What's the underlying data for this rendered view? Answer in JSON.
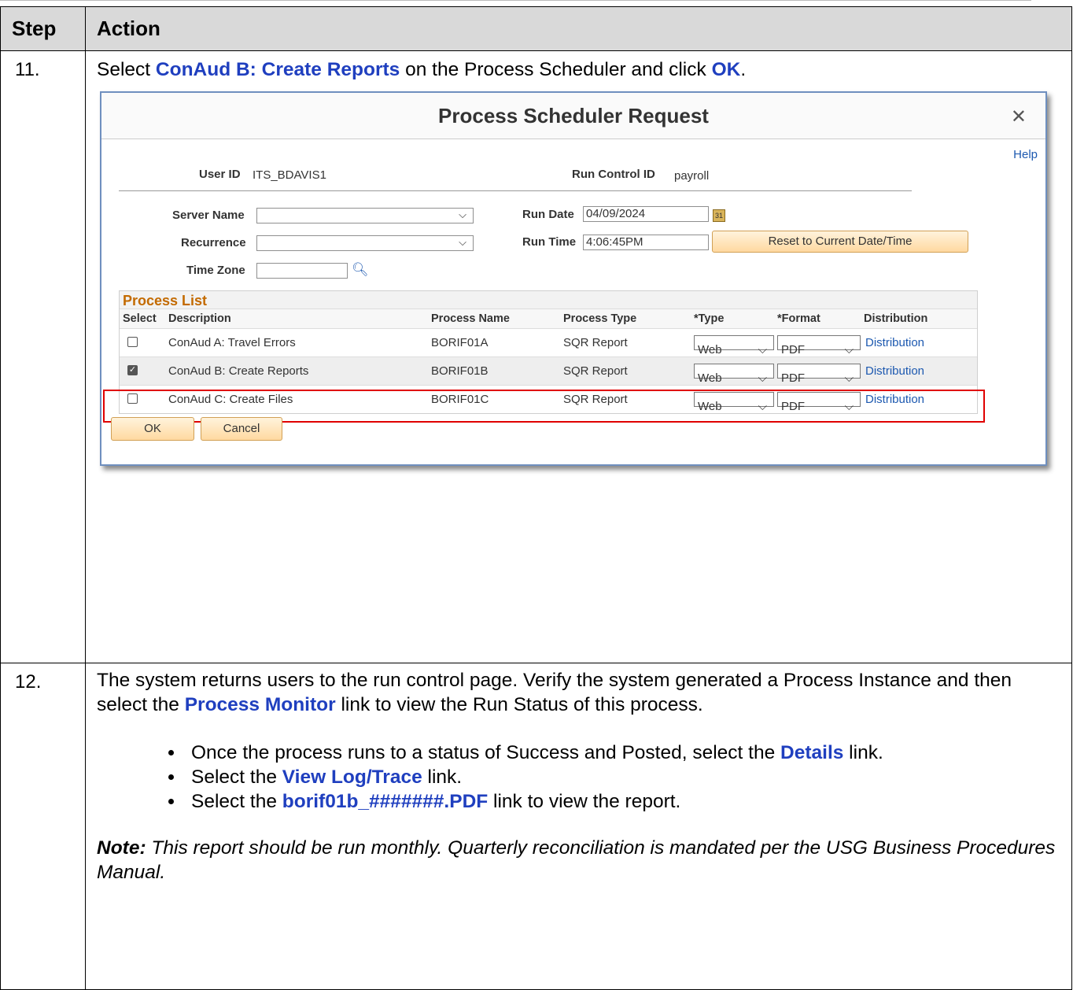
{
  "table": {
    "header_step": "Step",
    "header_action": "Action"
  },
  "step11": {
    "number": "11.",
    "text_prefix": "Select ",
    "link1": "ConAud B: Create Reports",
    "text_mid": " on the Process Scheduler and click ",
    "link2": "OK",
    "text_suffix": "."
  },
  "dialog": {
    "title": "Process Scheduler Request",
    "close_icon": "close-icon",
    "help": "Help",
    "user_id_label": "User ID",
    "user_id_value": "ITS_BDAVIS1",
    "run_control_label": "Run Control ID",
    "run_control_value": "payroll",
    "server_name_label": "Server Name",
    "server_name_value": "",
    "recurrence_label": "Recurrence",
    "recurrence_value": "",
    "time_zone_label": "Time Zone",
    "time_zone_value": "",
    "run_date_label": "Run Date",
    "run_date_value": "04/09/2024",
    "run_time_label": "Run Time",
    "run_time_value": "4:06:45PM",
    "reset_button": "Reset to Current Date/Time",
    "process_list_title": "Process List",
    "columns": [
      "Select",
      "Description",
      "Process Name",
      "Process Type",
      "*Type",
      "*Format",
      "Distribution"
    ],
    "rows": [
      {
        "checked": false,
        "description": "ConAud A: Travel Errors",
        "process_name": "BORIF01A",
        "process_type": "SQR Report",
        "type": "Web",
        "format": "PDF",
        "distribution": "Distribution"
      },
      {
        "checked": true,
        "description": "ConAud B: Create Reports",
        "process_name": "BORIF01B",
        "process_type": "SQR Report",
        "type": "Web",
        "format": "PDF",
        "distribution": "Distribution"
      },
      {
        "checked": false,
        "description": "ConAud C: Create Files",
        "process_name": "BORIF01C",
        "process_type": "SQR Report",
        "type": "Web",
        "format": "PDF",
        "distribution": "Distribution"
      }
    ],
    "ok_button": "OK",
    "cancel_button": "Cancel",
    "colors": {
      "border": "#6f8fbf",
      "highlight": "#e00000",
      "process_list_title": "#c36a00"
    }
  },
  "step12": {
    "number": "12.",
    "p1_a": "The system returns users to the run control page. Verify the system generated a Process Instance and then select the ",
    "p1_link": "Process Monitor",
    "p1_b": " link to view the Run Status of this process.",
    "b1_a": "Once the process runs to a status of Success and Posted, select the ",
    "b1_link": "Details",
    "b1_b": " link.",
    "b2_a": "Select the ",
    "b2_link": "View Log/Trace",
    "b2_b": " link.",
    "b3_a": "Select the ",
    "b3_link": "borif01b_#######.PDF",
    "b3_b": " link to view the report.",
    "note_label": "Note:",
    "note_text": " This report should be run monthly.  Quarterly reconciliation is mandated per the USG Business Procedures Manual."
  }
}
